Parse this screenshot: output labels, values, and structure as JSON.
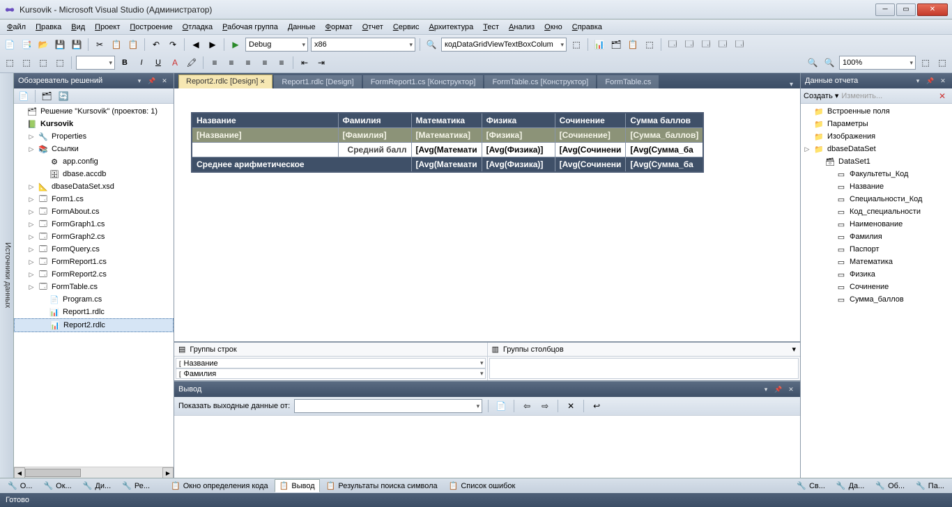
{
  "title": "Kursovik - Microsoft Visual Studio (Администратор)",
  "menu": [
    "Файл",
    "Правка",
    "Вид",
    "Проект",
    "Построение",
    "Отладка",
    "Рабочая группа",
    "Данные",
    "Формат",
    "Отчет",
    "Сервис",
    "Архитектура",
    "Тест",
    "Анализ",
    "Окно",
    "Справка"
  ],
  "toolbar": {
    "config": "Debug",
    "platform": "x86",
    "find": "кодDataGridViewTextBoxColum",
    "zoom": "100%"
  },
  "solution": {
    "title": "Обозреватель решений",
    "root": "Решение \"Kursovik\" (проектов: 1)",
    "project": "Kursovik",
    "items": [
      {
        "name": "Properties",
        "icon": "props",
        "exp": true
      },
      {
        "name": "Ссылки",
        "icon": "refs",
        "exp": true
      },
      {
        "name": "app.config",
        "icon": "cfg",
        "exp": false,
        "indent": 1
      },
      {
        "name": "dbase.accdb",
        "icon": "db",
        "exp": false,
        "indent": 1
      },
      {
        "name": "dbaseDataSet.xsd",
        "icon": "xsd",
        "exp": true
      },
      {
        "name": "Form1.cs",
        "icon": "form",
        "exp": true
      },
      {
        "name": "FormAbout.cs",
        "icon": "form",
        "exp": true
      },
      {
        "name": "FormGraph1.cs",
        "icon": "form",
        "exp": true
      },
      {
        "name": "FormGraph2.cs",
        "icon": "form",
        "exp": true
      },
      {
        "name": "FormQuery.cs",
        "icon": "form",
        "exp": true
      },
      {
        "name": "FormReport1.cs",
        "icon": "form",
        "exp": true
      },
      {
        "name": "FormReport2.cs",
        "icon": "form",
        "exp": true
      },
      {
        "name": "FormTable.cs",
        "icon": "form",
        "exp": true
      },
      {
        "name": "Program.cs",
        "icon": "cs",
        "exp": false,
        "indent": 1
      },
      {
        "name": "Report1.rdlc",
        "icon": "rdlc",
        "exp": false,
        "indent": 1
      },
      {
        "name": "Report2.rdlc",
        "icon": "rdlc",
        "exp": false,
        "indent": 1,
        "selected": true
      }
    ]
  },
  "tabs": [
    "Report2.rdlc [Design]",
    "Report1.rdlc [Design]",
    "FormReport1.cs [Конструктор]",
    "FormTable.cs [Конструктор]",
    "FormTable.cs"
  ],
  "activeTab": 0,
  "report": {
    "headers": [
      "Название",
      "Фамилия",
      "Математика",
      "Физика",
      "Сочинение",
      "Сумма баллов"
    ],
    "dataRow": [
      "[Название]",
      "[Фамилия]",
      "[Математика]",
      "[Физика]",
      "[Сочинение]",
      "[Сумма_баллов]"
    ],
    "avg1Label": "Средний балл",
    "avg1": [
      "",
      "",
      "[Avg(Математи",
      "[Avg(Физика)]",
      "[Avg(Сочинени",
      "[Avg(Сумма_ба"
    ],
    "avg2Label": "Среднее арифметическое",
    "avg2": [
      "",
      "",
      "[Avg(Математи",
      "[Avg(Физика)]",
      "[Avg(Сочинени",
      "[Avg(Сумма_ба"
    ]
  },
  "groups": {
    "rowsLabel": "Группы строк",
    "colsLabel": "Группы столбцов",
    "rowGroups": [
      "Название",
      "Фамилия"
    ]
  },
  "output": {
    "title": "Вывод",
    "showFrom": "Показать выходные данные от:"
  },
  "reportData": {
    "title": "Данные отчета",
    "create": "Создать",
    "edit": "Изменить...",
    "folders": [
      "Встроенные поля",
      "Параметры",
      "Изображения",
      "dbaseDataSet"
    ],
    "dataset": "DataSet1",
    "fields": [
      "Факультеты_Код",
      "Название",
      "Специальности_Код",
      "Код_специальности",
      "Наименование",
      "Фамилия",
      "Паспорт",
      "Математика",
      "Физика",
      "Сочинение",
      "Сумма_баллов"
    ]
  },
  "vtab": "Источники данных",
  "bottomLeft": [
    "О...",
    "Ок...",
    "Ди...",
    "Ре..."
  ],
  "bottomCenter": [
    "Окно определения кода",
    "Вывод",
    "Результаты поиска символа",
    "Список ошибок"
  ],
  "bottomCenterActive": 1,
  "bottomRight": [
    "Св...",
    "Да...",
    "Об...",
    "Па..."
  ],
  "status": "Готово"
}
